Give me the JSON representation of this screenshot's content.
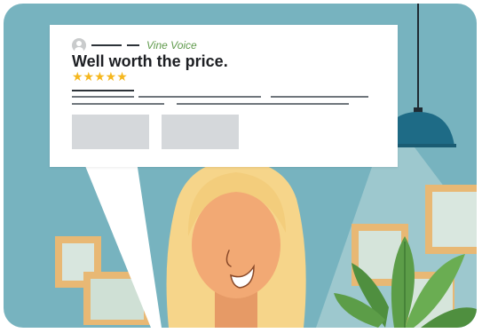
{
  "review": {
    "badge": "Vine Voice",
    "headline": "Well worth the price.",
    "stars": "★★★★★",
    "rating": 5,
    "star_color": "#f5b71e"
  },
  "colors": {
    "wall": "#77b3bf",
    "lamp": "#1e6b86",
    "hair": "#f6d58a",
    "skin": "#f2a974",
    "plant": "#5c9d48"
  },
  "icons": [
    "user-avatar-icon",
    "star-icon",
    "lamp-icon",
    "plant-icon",
    "picture-frame-icon"
  ]
}
